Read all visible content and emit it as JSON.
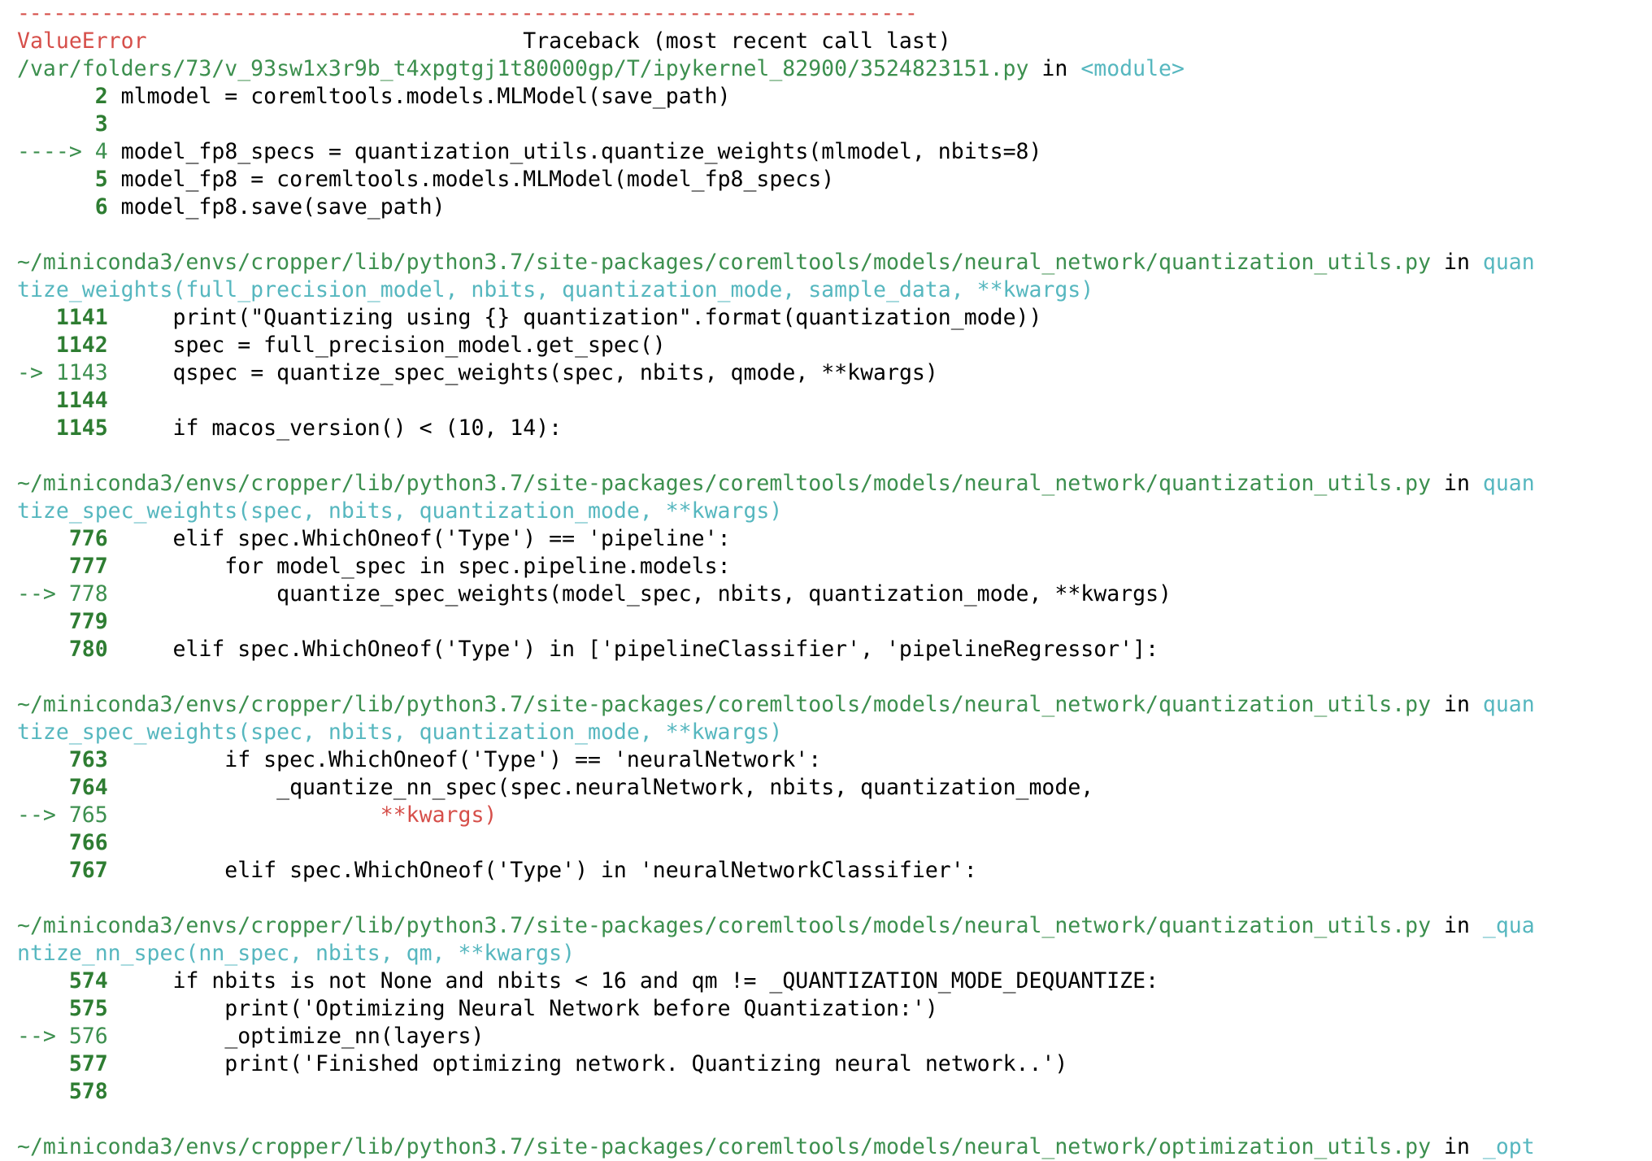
{
  "traceback": {
    "divider": "---------------------------------------------------------------------------",
    "error_type": "ValueError",
    "header": "Traceback (most recent call last)",
    "frame0": {
      "file": "/var/folders/73/v_93sw1x3r9b_t4xpgtgj1t80000gp/T/ipykernel_82900/3524823151.py",
      "in": "in",
      "func": "<module>",
      "l1": {
        "no": "2",
        "code": "mlmodel = coremltools.models.MLModel(save_path)"
      },
      "l2": {
        "no": "3"
      },
      "l3": {
        "arrow": "---->",
        "no": "4",
        "code": "model_fp8_specs = quantization_utils.quantize_weights(mlmodel, nbits=8)"
      },
      "l4": {
        "no": "5",
        "code": "model_fp8 = coremltools.models.MLModel(model_fp8_specs)"
      },
      "l5": {
        "no": "6",
        "code": "model_fp8.save(save_path)"
      }
    },
    "frame1": {
      "file": "~/miniconda3/envs/cropper/lib/python3.7/site-packages/coremltools/models/neural_network/quantization_utils.py",
      "in": "in",
      "func1": "quan",
      "func2": "tize_weights(full_precision_model, nbits, quantization_mode, sample_data, **kwargs)",
      "l1": {
        "no": "1141",
        "code": "    print(\"Quantizing using {} quantization\".format(quantization_mode))"
      },
      "l2": {
        "no": "1142",
        "code": "    spec = full_precision_model.get_spec()"
      },
      "l3": {
        "arrow": "->",
        "no": "1143",
        "code": "    qspec = quantize_spec_weights(spec, nbits, qmode, **kwargs)"
      },
      "l4": {
        "no": "1144"
      },
      "l5": {
        "no": "1145",
        "code": "    if macos_version() < (10, 14):"
      }
    },
    "frame2": {
      "file": "~/miniconda3/envs/cropper/lib/python3.7/site-packages/coremltools/models/neural_network/quantization_utils.py",
      "in": "in",
      "func1": "quan",
      "func2": "tize_spec_weights(spec, nbits, quantization_mode, **kwargs)",
      "l1": {
        "no": "776",
        "code": "    elif spec.WhichOneof('Type') == 'pipeline':"
      },
      "l2": {
        "no": "777",
        "code": "        for model_spec in spec.pipeline.models:"
      },
      "l3": {
        "arrow": "-->",
        "no": "778",
        "code": "            quantize_spec_weights(model_spec, nbits, quantization_mode, **kwargs)"
      },
      "l4": {
        "no": "779"
      },
      "l5": {
        "no": "780",
        "code": "    elif spec.WhichOneof('Type') in ['pipelineClassifier', 'pipelineRegressor']:"
      }
    },
    "frame3": {
      "file": "~/miniconda3/envs/cropper/lib/python3.7/site-packages/coremltools/models/neural_network/quantization_utils.py",
      "in": "in",
      "func1": "quan",
      "func2": "tize_spec_weights(spec, nbits, quantization_mode, **kwargs)",
      "l1": {
        "no": "763",
        "code": "        if spec.WhichOneof('Type') == 'neuralNetwork':"
      },
      "l2": {
        "no": "764",
        "code": "            _quantize_nn_spec(spec.neuralNetwork, nbits, quantization_mode,"
      },
      "l3": {
        "arrow": "-->",
        "no": "765",
        "code": "                    **kwargs)"
      },
      "l4": {
        "no": "766"
      },
      "l5": {
        "no": "767",
        "code": "        elif spec.WhichOneof('Type') in 'neuralNetworkClassifier':"
      }
    },
    "frame4": {
      "file": "~/miniconda3/envs/cropper/lib/python3.7/site-packages/coremltools/models/neural_network/quantization_utils.py",
      "in": "in",
      "func1": "_qua",
      "func2": "ntize_nn_spec(nn_spec, nbits, qm, **kwargs)",
      "l1": {
        "no": "574",
        "code": "    if nbits is not None and nbits < 16 and qm != _QUANTIZATION_MODE_DEQUANTIZE:"
      },
      "l2": {
        "no": "575",
        "code": "        print('Optimizing Neural Network before Quantization:')"
      },
      "l3": {
        "arrow": "-->",
        "no": "576",
        "code": "        _optimize_nn(layers)"
      },
      "l4": {
        "no": "577",
        "code": "        print('Finished optimizing network. Quantizing neural network..')"
      },
      "l5": {
        "no": "578"
      }
    },
    "frame5": {
      "file": "~/miniconda3/envs/cropper/lib/python3.7/site-packages/coremltools/models/neural_network/optimization_utils.py",
      "in": "in",
      "func1": "_opt"
    }
  }
}
